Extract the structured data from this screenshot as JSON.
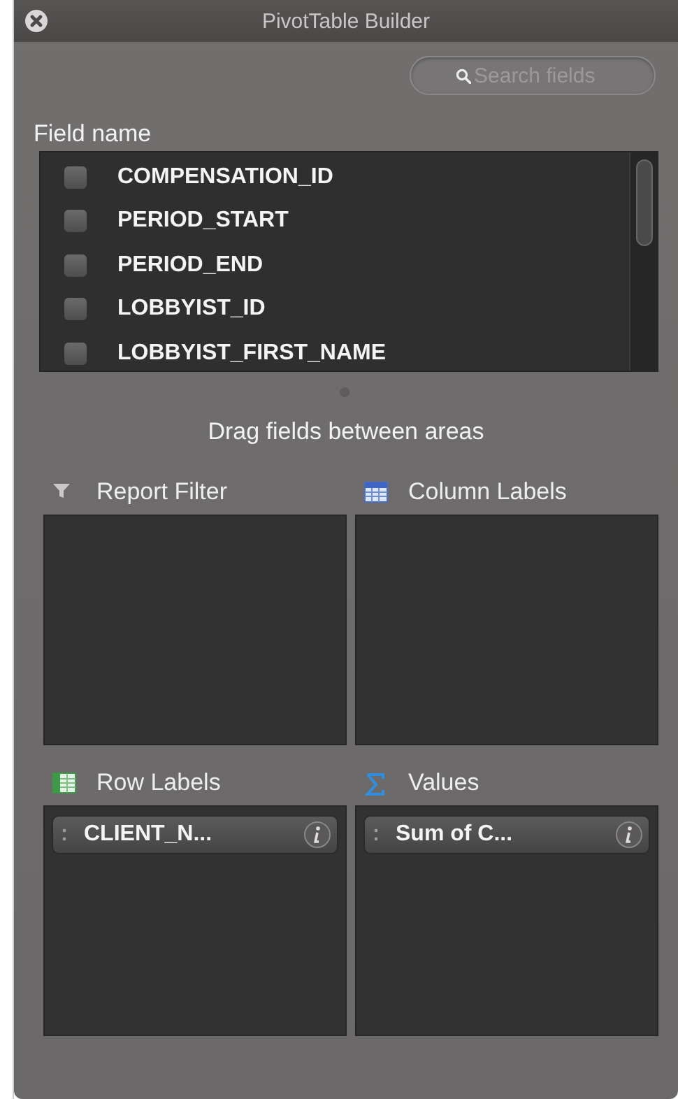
{
  "window": {
    "title": "PivotTable Builder"
  },
  "search": {
    "placeholder": "Search fields"
  },
  "field_list": {
    "heading": "Field name",
    "fields": [
      {
        "name": "COMPENSATION_ID",
        "checked": false
      },
      {
        "name": "PERIOD_START",
        "checked": false
      },
      {
        "name": "PERIOD_END",
        "checked": false
      },
      {
        "name": "LOBBYIST_ID",
        "checked": false
      },
      {
        "name": "LOBBYIST_FIRST_NAME",
        "checked": false
      }
    ]
  },
  "hint": "Drag fields between areas",
  "areas": [
    {
      "kind": "filter",
      "label": "Report Filter"
    },
    {
      "kind": "columns",
      "label": "Column Labels"
    },
    {
      "kind": "rows",
      "label": "Row Labels",
      "items": [
        "CLIENT_N..."
      ]
    },
    {
      "kind": "values",
      "label": "Values",
      "items": [
        "Sum of C..."
      ]
    }
  ]
}
